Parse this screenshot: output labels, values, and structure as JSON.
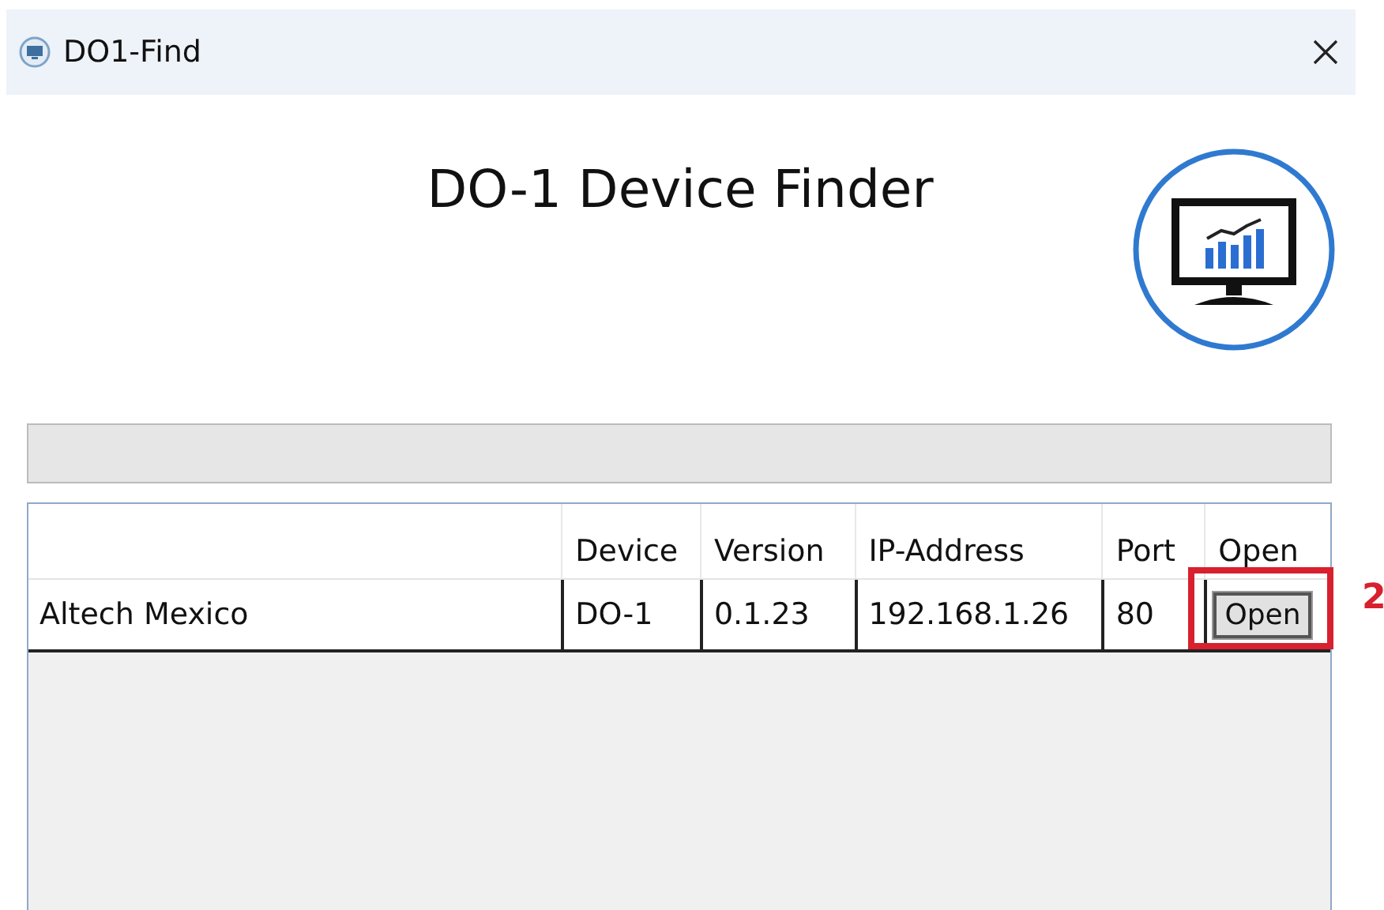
{
  "window": {
    "title": "DO1-Find"
  },
  "heading": "DO-1 Device Finder",
  "table": {
    "columns": [
      "",
      "Device",
      "Version",
      "IP-Address",
      "Port",
      "Open"
    ],
    "rows": [
      {
        "cells": [
          "Altech Mexico",
          "DO-1",
          "0.1.23",
          "192.168.1.26",
          "80"
        ],
        "button": "Open"
      }
    ]
  },
  "annotation": {
    "label": "2"
  }
}
